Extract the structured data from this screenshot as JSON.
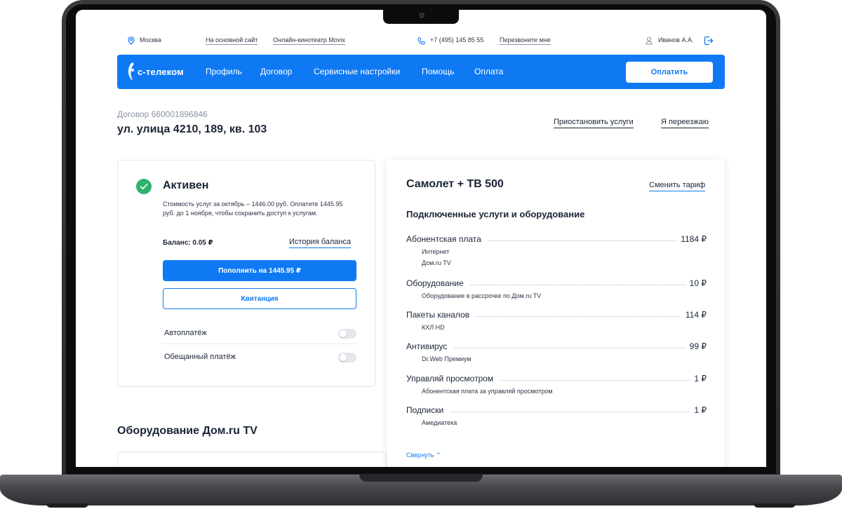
{
  "topbar": {
    "city": "Москва",
    "main_site": "На основной сайт",
    "cinema": "Онлайн-кинотеатр Movix",
    "phone": "+7 (495) 145 85 55",
    "callback": "Перезвоните мне",
    "user": "Иванов А.А."
  },
  "navbar": {
    "logo": "с-телеком",
    "items": [
      "Профиль",
      "Договор",
      "Сервисные настройки",
      "Помощь",
      "Оплата"
    ],
    "pay_button": "Оплатить"
  },
  "contract": {
    "number": "Договор 660001896846",
    "address": "ул. улица 4210, 189, кв. 103",
    "suspend_link": "Приостановить услуги",
    "moving_link": "Я переезжаю"
  },
  "status": {
    "title": "Активен",
    "description": "Стоимость услуг за октябрь – 1446.00 руб. Оплатите 1445.95 руб. до 1 ноября, чтобы сохранить доступ к услугам.",
    "balance": "Баланс: 0.05 ₽",
    "history_link": "История баланса",
    "topup_button": "Пополнить на 1445.95 ₽",
    "receipt_button": "Квитанция",
    "toggles": [
      {
        "label": "Автоплатёж",
        "on": false
      },
      {
        "label": "Обещанный платёж",
        "on": false
      }
    ]
  },
  "equipment": {
    "title": "Оборудование Дом.ru TV"
  },
  "tariff": {
    "name": "Самолет + ТВ 500",
    "change_link": "Сменить тариф",
    "services_title": "Подключенные услуги и оборудование",
    "services": [
      {
        "name": "Абонентская плата",
        "price": "1184 ₽",
        "subs": [
          "Интернет",
          "Дом.ru TV"
        ]
      },
      {
        "name": "Оборудование",
        "price": "10 ₽",
        "subs": [
          "Оборудование в рассрочке по Дом.ru TV"
        ]
      },
      {
        "name": "Пакеты каналов",
        "price": "114 ₽",
        "subs": [
          "КХЛ HD"
        ]
      },
      {
        "name": "Антивирус",
        "price": "99 ₽",
        "subs": [
          "Dr.Web Премиум"
        ]
      },
      {
        "name": "Управляй просмотром",
        "price": "1 ₽",
        "subs": [
          "Абонентская плата за управляй просмотром"
        ]
      },
      {
        "name": "Подписки",
        "price": "1 ₽",
        "subs": [
          "Амедиатека"
        ]
      }
    ],
    "collapse_link": "Свернуть ⌃"
  },
  "colors": {
    "brand_blue": "#0f79f3",
    "success_green": "#2fb36b",
    "text_dark": "#1b2437",
    "text_muted": "#8a93a3"
  },
  "icons": [
    "location-pin-icon",
    "phone-icon",
    "user-icon",
    "logout-icon",
    "check-icon",
    "logo-mark-icon"
  ]
}
